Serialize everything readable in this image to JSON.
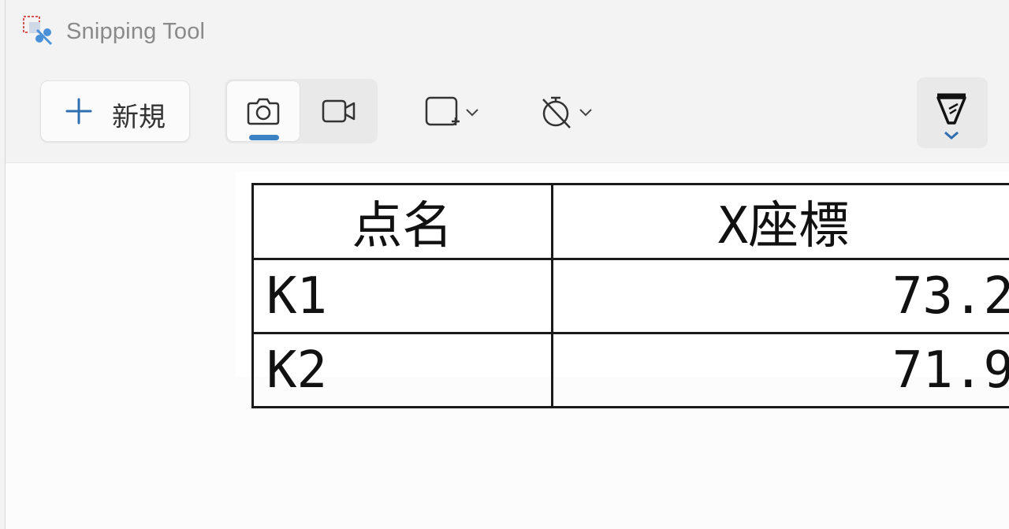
{
  "app": {
    "title": "Snipping Tool"
  },
  "toolbar": {
    "new_label": "新規",
    "modes": [
      {
        "name": "screenshot",
        "icon": "camera-icon",
        "active": true
      },
      {
        "name": "record",
        "icon": "video-icon",
        "active": false
      }
    ],
    "snip_shape_icon": "rectangle-snip-icon",
    "delay_icon": "no-delay-timer-icon",
    "pen_icon": "pen-icon"
  },
  "colors": {
    "accent": "#3b82c4",
    "window_bg": "#f3f3f3",
    "canvas_bg": "#fcfcfc"
  },
  "content": {
    "table": {
      "headers": [
        "点名",
        "X座標"
      ],
      "rows": [
        {
          "name": "K1",
          "x": "73.2"
        },
        {
          "name": "K2",
          "x": "71.9"
        }
      ]
    }
  }
}
